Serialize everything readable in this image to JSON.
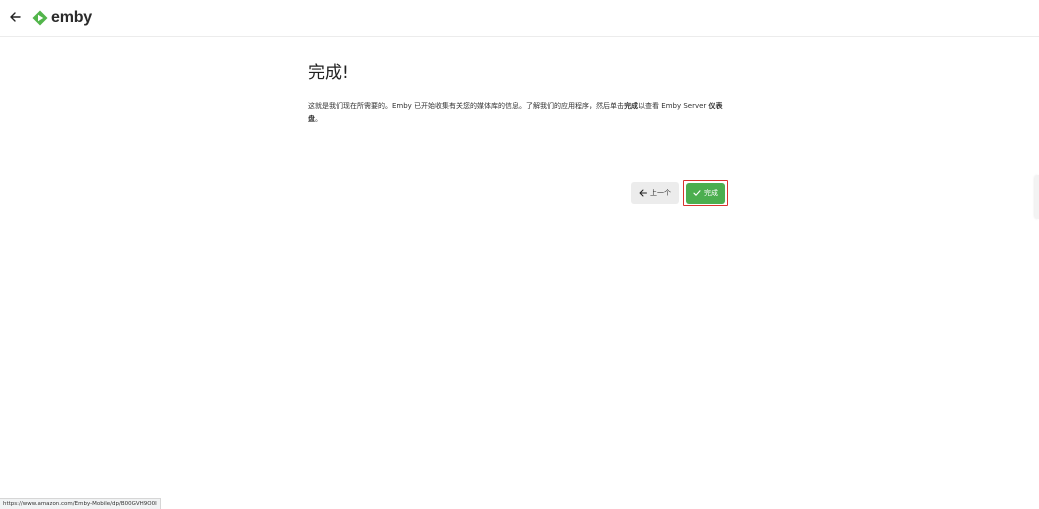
{
  "header": {
    "logo_text": "emby",
    "brand_color": "#52b54b"
  },
  "main": {
    "title": "完成!",
    "desc_text": "这就是我们现在所需要的。Emby 已开始收集有关您的媒体库的信息。了解我们的应用程序，然后单击",
    "desc_bold_1": "完成",
    "desc_text_2": "以查看 Emby Server ",
    "desc_bold_2": "仪表盘",
    "desc_end": "。"
  },
  "buttons": {
    "prev_label": "上一个",
    "finish_label": "完成"
  },
  "status_bar": {
    "url": "https://www.amazon.com/Emby-Mobile/dp/B00GVH9O0I"
  }
}
